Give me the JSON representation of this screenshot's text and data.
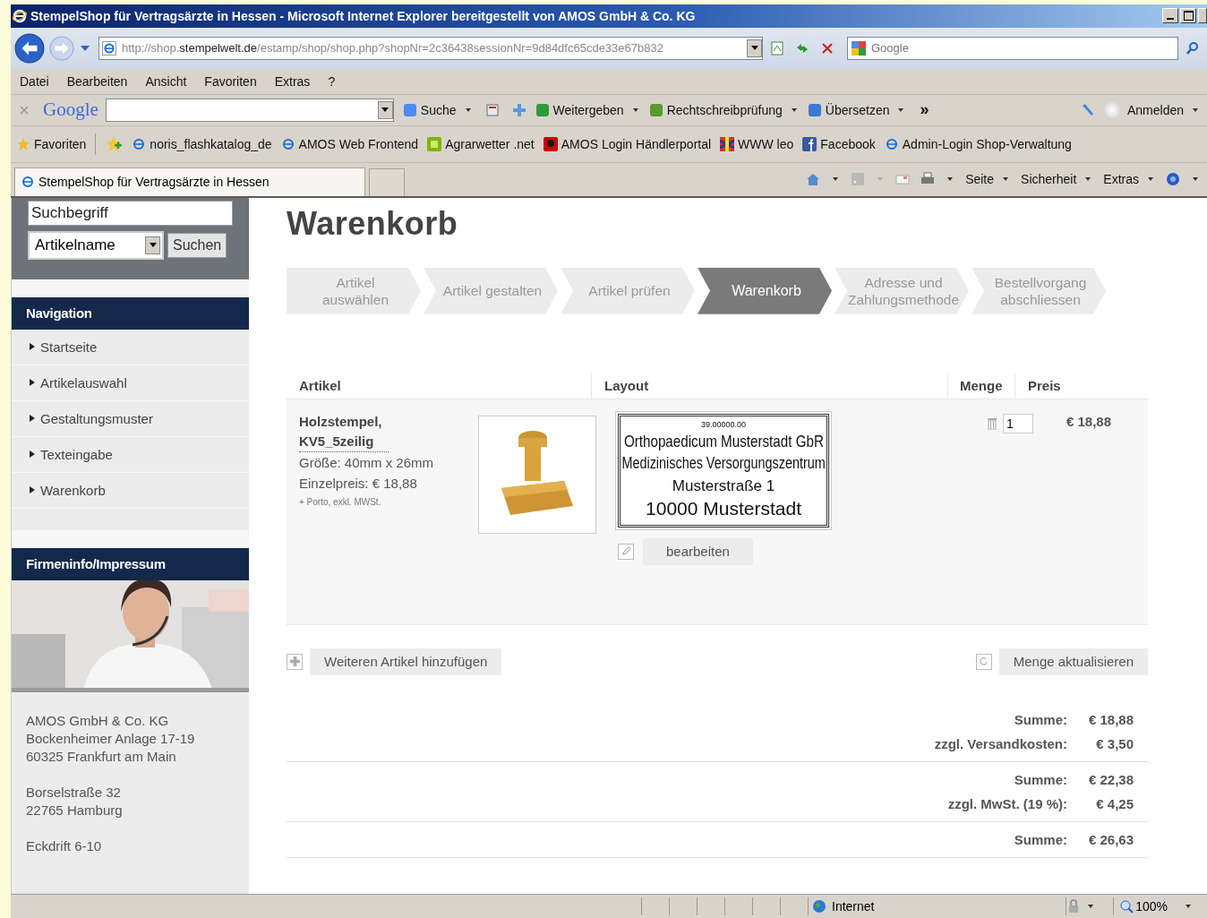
{
  "window": {
    "title": "StempelShop für Vertragsärzte in Hessen - Microsoft Internet Explorer bereitgestellt von AMOS GmbH & Co. KG"
  },
  "address_bar": {
    "url_prefix": "http://shop.",
    "url_domain": "stempelwelt.de",
    "url_path": "/estamp/shop/shop.php?shopNr=2c36438sessionNr=9d84dfc65cde33e67b832",
    "search_placeholder": "Google"
  },
  "menu": [
    "Datei",
    "Bearbeiten",
    "Ansicht",
    "Favoriten",
    "Extras",
    "?"
  ],
  "google_toolbar": {
    "logo": "Google",
    "items": [
      {
        "label": "Suche",
        "kind": "search"
      },
      {
        "label": "Weitergeben",
        "kind": "share"
      },
      {
        "label": "Rechtschreibprüfung",
        "kind": "spell"
      },
      {
        "label": "Übersetzen",
        "kind": "translate"
      }
    ],
    "more": "»",
    "signin": "Anmelden"
  },
  "favorites": {
    "label": "Favoriten",
    "links": [
      {
        "label": "noris_flashkatalog_de",
        "kind": "ie"
      },
      {
        "label": "AMOS Web Frontend",
        "kind": "ie"
      },
      {
        "label": "Agrarwetter .net",
        "kind": "green"
      },
      {
        "label": "AMOS  Login Händlerportal",
        "kind": "amos"
      },
      {
        "label": "WWW leo",
        "kind": "flag"
      },
      {
        "label": "Facebook",
        "kind": "facebook"
      },
      {
        "label": "Admin-Login Shop-Verwaltung",
        "kind": "ie"
      }
    ]
  },
  "tab": {
    "title": "StempelShop für Vertragsärzte in Hessen"
  },
  "command_bar": [
    "Seite",
    "Sicherheit",
    "Extras"
  ],
  "sidebar": {
    "search_value": "Suchbegriff",
    "search_scope": "Artikelname",
    "search_button": "Suchen",
    "navigation": {
      "title": "Navigation",
      "items": [
        "Startseite",
        "Artikelauswahl",
        "Gestaltungsmuster",
        "Texteingabe",
        "Warenkorb"
      ]
    },
    "company": {
      "title": "Firmeninfo/Impressum",
      "photo": {
        "kind": "picture"
      },
      "addresses": [
        [
          "AMOS GmbH & Co. KG",
          "Bockenheimer Anlage 17-19",
          "60325 Frankfurt am Main"
        ],
        [
          "Borselstraße 32",
          "22765 Hamburg"
        ],
        [
          "Eckdrift 6-10"
        ]
      ]
    }
  },
  "main": {
    "heading": "Warenkorb",
    "steps": [
      {
        "label": "Artikel auswählen",
        "selected": false
      },
      {
        "label": "Artikel gestalten",
        "selected": false
      },
      {
        "label": "Artikel prüfen",
        "selected": false
      },
      {
        "label": "Warenkorb",
        "selected": true
      },
      {
        "label": "Adresse und Zahlungsmethode",
        "selected": false
      },
      {
        "label": "Bestellvorgang abschliessen",
        "selected": false
      }
    ],
    "columns": [
      "Artikel",
      "Layout",
      "Menge",
      "Preis"
    ],
    "items": [
      {
        "name": "Holzstempel, KV5_5zeilig",
        "size": "Größe: 40mm x 26mm",
        "unit_price": "Einzelpreis: € 18,88",
        "note": "+ Porto, exkl. MWSt.",
        "layout_lines": [
          "39.00000.00",
          "Orthopaedicum Musterstadt GbR",
          "Medizinisches Versorgungszentrum",
          "Musterstraße 1",
          "10000 Musterstadt"
        ],
        "edit_button": "bearbeiten",
        "quantity": "1",
        "price": "€ 18,88"
      }
    ],
    "add_button": "Weiteren Artikel hinzufügen",
    "update_button": "Menge aktualisieren",
    "totals": [
      [
        {
          "label": "Summe:",
          "value": "€ 18,88"
        },
        {
          "label": "zzgl. Versandkosten:",
          "value": "€ 3,50"
        }
      ],
      [
        {
          "label": "Summe:",
          "value": "€ 22,38"
        },
        {
          "label": "zzgl. MwSt. (19 %):",
          "value": "€ 4,25"
        }
      ],
      [
        {
          "label": "Summe:",
          "value": "€ 26,63"
        }
      ]
    ]
  },
  "status_bar": {
    "zone": "Internet",
    "zoom": "100%"
  }
}
